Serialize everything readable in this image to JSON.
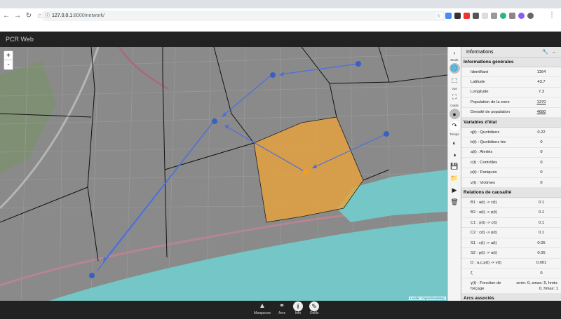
{
  "browser": {
    "url_host": "127.0.0.1",
    "url_path": ":8000/network/"
  },
  "app": {
    "title": "PCR Web"
  },
  "map": {
    "zoom_in": "+",
    "zoom_out": "-",
    "attribution_1": "Leaflet",
    "attribution_sep": " | ",
    "attribution_2": "OpenStreetMap"
  },
  "tools": {
    "mode_label": "Mode",
    "vue_label": "Vue",
    "outils_label": "Outils",
    "temps_label": "Temps"
  },
  "panel": {
    "title": "Informations",
    "general_heading": "Informations générales",
    "general": [
      {
        "k": "Identifiant",
        "v": "1164",
        "link": false
      },
      {
        "k": "Latitude",
        "v": "43.7",
        "link": false
      },
      {
        "k": "Longitude",
        "v": "7.3",
        "link": false
      },
      {
        "k": "Population de la zone",
        "v": "1370",
        "link": true
      },
      {
        "k": "Densité de population",
        "v": "4680",
        "link": true
      }
    ],
    "state_heading": "Variables d'état",
    "state": [
      {
        "k": "q(t) : Quotidiens",
        "v": "0.22"
      },
      {
        "k": "b(t) : Quotidiens bis",
        "v": "0"
      },
      {
        "k": "a(t) : Alertés",
        "v": "0"
      },
      {
        "k": "c(t) : Contrôlés",
        "v": "0"
      },
      {
        "k": "p(t) : Paniqués",
        "v": "0"
      },
      {
        "k": "v(t) : Victimes",
        "v": "0"
      }
    ],
    "causal_heading": "Relations de causalité",
    "causal": [
      {
        "k": "B1 : a(t) -> c(t)",
        "v": "0.1"
      },
      {
        "k": "B2 : a(t) -> p(t)",
        "v": "0.1"
      },
      {
        "k": "C1 : p(t) -> c(t)",
        "v": "0.1"
      },
      {
        "k": "C2 : c(t) -> p(t)",
        "v": "0.1"
      },
      {
        "k": "S1 : c(t) -> a(t)",
        "v": "0.05"
      },
      {
        "k": "S2 : p(t) -> a(t)",
        "v": "0.05"
      },
      {
        "k": "D : a,c,p(t) -> v(t)",
        "v": "0.001"
      },
      {
        "k": "ζ",
        "v": "0"
      }
    ],
    "forcing_key": "γ(t) : Fonction de forçage",
    "forcing_val": "smin: 0, smax: 5, hmin: 0, hmax: 1",
    "arcs_heading": "Arcs associés"
  },
  "bottom": {
    "marqueurs": "Marqueurs",
    "arcs": "Arcs",
    "info": "Info",
    "outils": "Outils"
  },
  "colors": {
    "highlight_zone": "#e8a23a",
    "arrow": "#4a6fe0",
    "node": "#3b5fc4",
    "sea": "#74c7c6"
  }
}
